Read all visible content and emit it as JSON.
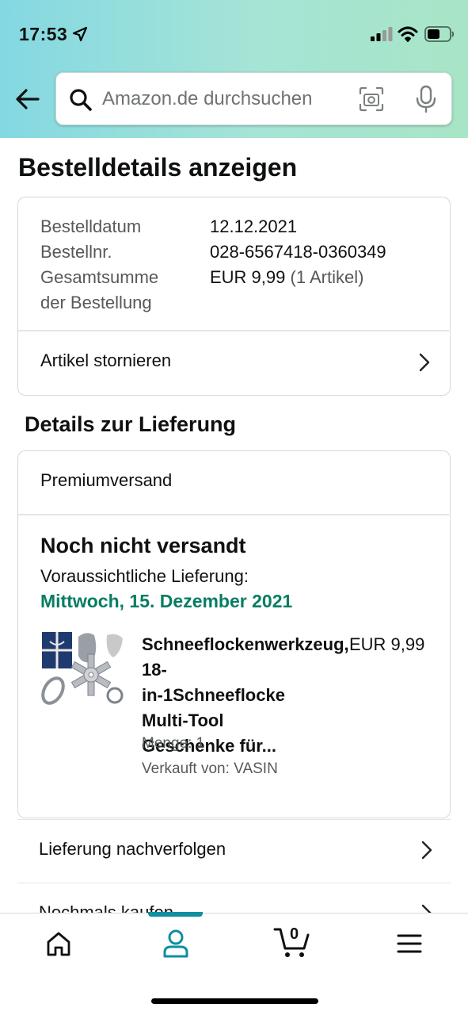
{
  "status_bar": {
    "time": "17:53"
  },
  "search": {
    "placeholder": "Amazon.de durchsuchen"
  },
  "page": {
    "title": "Bestelldetails anzeigen"
  },
  "order_summary": {
    "rows": [
      {
        "label": "Bestelldatum",
        "value": "12.12.2021"
      },
      {
        "label": "Bestellnr.",
        "value": "028-6567418-0360349"
      }
    ],
    "total_label_line1": "Gesamtsumme",
    "total_label_line2": "der Bestellung",
    "total_value": "EUR 9,99",
    "total_count": "(1 Artikel)",
    "cancel_label": "Artikel stornieren"
  },
  "delivery": {
    "section_title": "Details zur Lieferung",
    "shipping_method": "Premiumversand",
    "status": "Noch nicht versandt",
    "eta_label": "Voraussichtliche Lieferung:",
    "eta_date": "Mittwoch, 15. Dezember 2021",
    "item": {
      "title_lines": [
        "Schneeflockenwerkzeug, 18-",
        "in-1Schneeflocke",
        "Multi-Tool",
        "Geschenke für..."
      ],
      "price": "EUR 9,99",
      "quantity": "Menge: 1",
      "seller": "Verkauft von: VASIN"
    }
  },
  "actions": {
    "track_label": "Lieferung nachverfolgen",
    "buy_again_label": "Nochmals kaufen"
  },
  "tabbar": {
    "cart_count": "0",
    "tabs": [
      "home-icon",
      "account-icon",
      "cart-icon",
      "menu-icon"
    ],
    "active_tab": "account",
    "accent": "#0f8fa0"
  },
  "colors": {
    "delivery_date": "#067d62",
    "header_gradient_start": "#84d8e2",
    "header_gradient_end": "#a8e5c6"
  }
}
